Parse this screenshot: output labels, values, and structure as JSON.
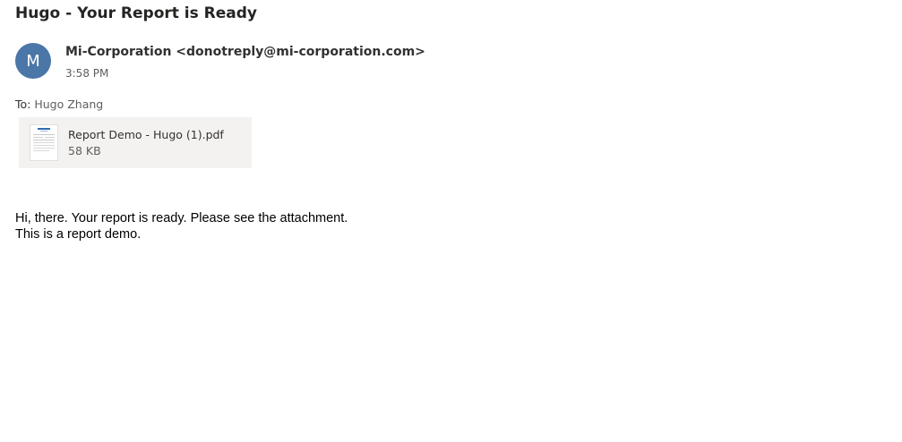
{
  "message": {
    "subject": "Hugo - Your Report is Ready",
    "avatar_initial": "M",
    "avatar_color": "#4a76a8",
    "sender_name": "Mi-Corporation",
    "sender_email": "<donotreply@mi-corporation.com>",
    "time": "3:58 PM",
    "to_label": "To:",
    "to_name": "Hugo Zhang"
  },
  "attachment": {
    "file_name": "Report Demo - Hugo (1).pdf",
    "file_size": "58 KB",
    "icon": "pdf-thumbnail-icon"
  },
  "body": {
    "lines": [
      "Hi, there. Your report is ready. Please see the attachment.",
      "This is a report demo."
    ]
  }
}
